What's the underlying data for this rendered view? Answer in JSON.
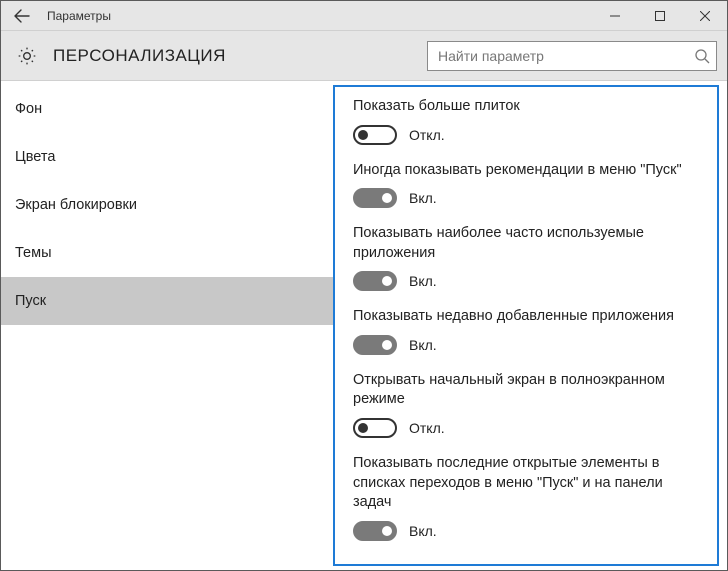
{
  "titlebar": {
    "title": "Параметры"
  },
  "header": {
    "heading": "ПЕРСОНАЛИЗАЦИЯ",
    "search_placeholder": "Найти параметр"
  },
  "sidebar": {
    "items": [
      {
        "label": "Фон"
      },
      {
        "label": "Цвета"
      },
      {
        "label": "Экран блокировки"
      },
      {
        "label": "Темы"
      },
      {
        "label": "Пуск"
      }
    ],
    "selected_index": 4
  },
  "toggle_labels": {
    "on": "Вкл.",
    "off": "Откл."
  },
  "settings": [
    {
      "label": "Показать больше плиток",
      "on": false
    },
    {
      "label": "Иногда показывать рекомендации в меню \"Пуск\"",
      "on": true
    },
    {
      "label": "Показывать наиболее часто используемые приложения",
      "on": true
    },
    {
      "label": "Показывать недавно добавленные приложения",
      "on": true
    },
    {
      "label": "Открывать начальный экран в полноэкранном режиме",
      "on": false
    },
    {
      "label": "Показывать последние открытые элементы в списках переходов в меню \"Пуск\" и на панели задач",
      "on": true
    }
  ]
}
